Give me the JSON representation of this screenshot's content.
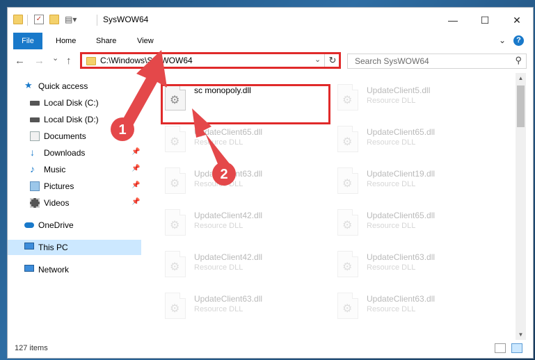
{
  "window": {
    "title": "SysWOW64",
    "controls": {
      "minimize": "—",
      "maximize": "☐",
      "close": "✕"
    }
  },
  "ribbon": {
    "tabs": [
      {
        "label": "File"
      },
      {
        "label": "Home"
      },
      {
        "label": "Share"
      },
      {
        "label": "View"
      }
    ],
    "expand_icon": "chevron-down-icon",
    "help_label": "?"
  },
  "navigation": {
    "address": "C:\\Windows\\SysWOW64",
    "search_placeholder": "Search SysWOW64",
    "back_glyph": "←",
    "forward_glyph": "→",
    "recent_glyph": "⌄",
    "up_glyph": "↑",
    "refresh_glyph": "↻",
    "search_glyph": "⚲"
  },
  "sidebar": {
    "items": [
      {
        "label": "Quick access",
        "icon": "star-icon"
      },
      {
        "label": "Local Disk (C:)",
        "icon": "drive-icon"
      },
      {
        "label": "Local Disk (D:)",
        "icon": "drive-icon"
      },
      {
        "label": "Documents",
        "icon": "documents-icon"
      },
      {
        "label": "Downloads",
        "icon": "download-icon"
      },
      {
        "label": "Music",
        "icon": "music-icon"
      },
      {
        "label": "Pictures",
        "icon": "pictures-icon"
      },
      {
        "label": "Videos",
        "icon": "video-icon"
      },
      {
        "label": "OneDrive",
        "icon": "cloud-icon"
      },
      {
        "label": "This PC",
        "icon": "computer-icon"
      },
      {
        "label": "Network",
        "icon": "network-icon"
      }
    ]
  },
  "files": [
    {
      "name": "sc monopoly.dll",
      "type": ""
    },
    {
      "name": "UpdateClient5.dll",
      "type": "Resource DLL"
    },
    {
      "name": "UpdateClient65.dll",
      "type": "Resource DLL"
    },
    {
      "name": "UpdateClient65.dll",
      "type": "Resource DLL"
    },
    {
      "name": "UpdateClient63.dll",
      "type": "Resource DLL"
    },
    {
      "name": "UpdateClient19.dll",
      "type": "Resource DLL"
    },
    {
      "name": "UpdateClient42.dll",
      "type": "Resource DLL"
    },
    {
      "name": "UpdateClient65.dll",
      "type": "Resource DLL"
    },
    {
      "name": "UpdateClient42.dll",
      "type": "Resource DLL"
    },
    {
      "name": "UpdateClient63.dll",
      "type": "Resource DLL"
    },
    {
      "name": "UpdateClient63.dll",
      "type": "Resource DLL"
    },
    {
      "name": "UpdateClient63.dll",
      "type": "Resource DLL"
    }
  ],
  "status": {
    "items_count": "127 items"
  },
  "annotations": {
    "step1": "1",
    "step2": "2"
  },
  "colors": {
    "accent": "#1979ca",
    "highlight": "#e02a2a",
    "selected": "#cce8ff"
  }
}
